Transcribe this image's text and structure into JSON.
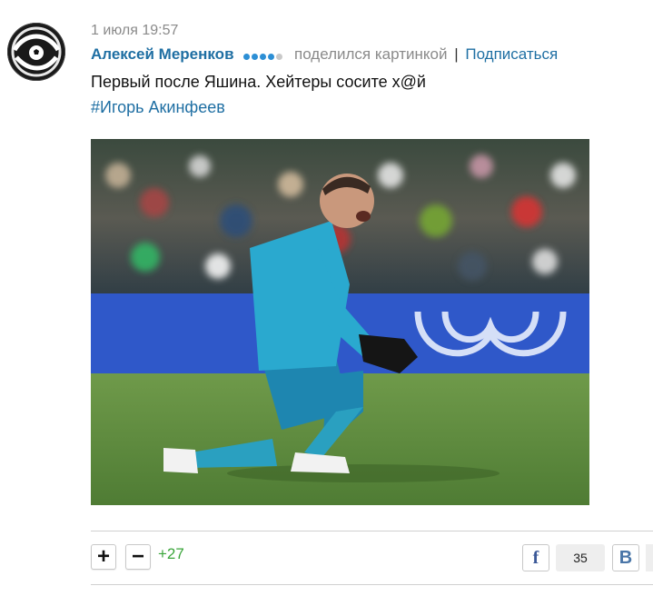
{
  "post": {
    "date": "1 июля 19:57",
    "author": "Алексей Меренков",
    "author_rating_dots": 5,
    "author_rating_filled": 4,
    "action": "поделился картинкой",
    "separator": "|",
    "subscribe_label": "Подписаться",
    "text": "Первый после Яшина. Хейтеры сосите х@й",
    "hashtag": "#Игорь Акинфеев"
  },
  "avatar": {
    "icon": "soccer-ball-icon"
  },
  "image": {
    "subject": "goalkeeper-celebrating-photo"
  },
  "footer": {
    "plus_label": "+",
    "minus_label": "−",
    "score": "+27",
    "share_facebook_label": "f",
    "share_count": "35",
    "share_vk_label": "B"
  },
  "colors": {
    "link_blue": "#1f6fa3",
    "score_green": "#3aa53a",
    "meta_gray": "#8a8a8a",
    "facebook": "#3b5998",
    "vk": "#4a76a8"
  }
}
